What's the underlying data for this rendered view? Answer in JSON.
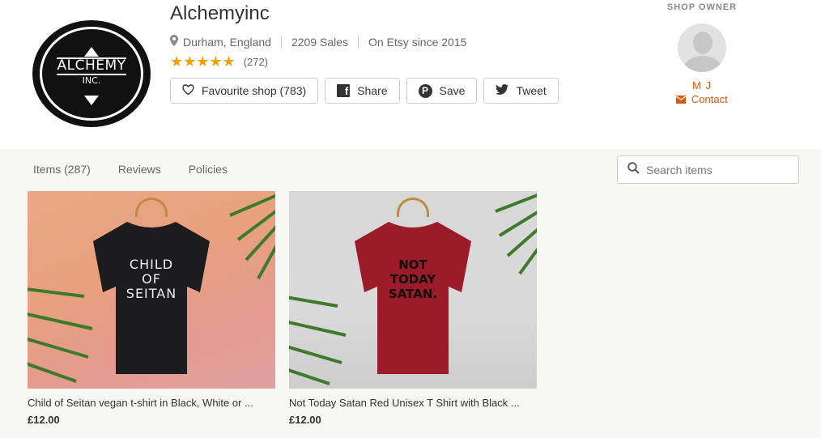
{
  "shop": {
    "name": "Alchemyinc",
    "logo_line1": "ALCHEMY",
    "logo_line2": "INC.",
    "location": "Durham, England",
    "sales": "2209 Sales",
    "since": "On Etsy since 2015",
    "stars": "★★★★★",
    "rating": 5,
    "review_count": "(272)"
  },
  "actions": {
    "favourite": "Favourite shop (783)",
    "share": "Share",
    "save": "Save",
    "tweet": "Tweet"
  },
  "owner": {
    "title": "SHOP OWNER",
    "name": "M J",
    "contact": "Contact"
  },
  "tabs": [
    "Items (287)",
    "Reviews",
    "Policies"
  ],
  "search": {
    "placeholder": "Search items"
  },
  "listings": [
    {
      "title": "Child of Seitan vegan t-shirt in Black, White or ...",
      "price": "£12.00",
      "shirt_text": [
        "CHILD",
        "OF",
        "SEITAN"
      ],
      "shirt_color": "#1c1c1e"
    },
    {
      "title": "Not Today Satan Red Unisex T Shirt with Black ...",
      "price": "£12.00",
      "shirt_text": [
        "NOT",
        "TODAY",
        "SATAN."
      ],
      "shirt_color": "#9b1b28"
    }
  ],
  "colors": {
    "accent": "#d8590b",
    "star": "#f1a200"
  }
}
